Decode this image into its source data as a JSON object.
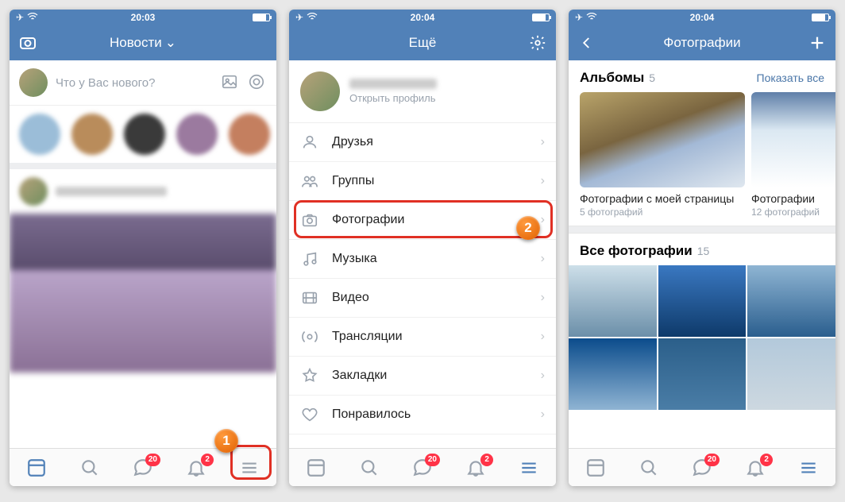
{
  "status": {
    "times": [
      "20:03",
      "20:04",
      "20:04"
    ]
  },
  "screen1": {
    "title": "Новости",
    "composer_placeholder": "Что у Вас нового?"
  },
  "screen2": {
    "title": "Ещё",
    "profile_sub": "Открыть профиль",
    "menu": [
      {
        "icon": "friends",
        "label": "Друзья"
      },
      {
        "icon": "groups",
        "label": "Группы"
      },
      {
        "icon": "photos",
        "label": "Фотографии"
      },
      {
        "icon": "music",
        "label": "Музыка"
      },
      {
        "icon": "video",
        "label": "Видео"
      },
      {
        "icon": "live",
        "label": "Трансляции"
      },
      {
        "icon": "bookmarks",
        "label": "Закладки"
      },
      {
        "icon": "likes",
        "label": "Понравилось"
      }
    ]
  },
  "screen3": {
    "title": "Фотографии",
    "albums_title": "Альбомы",
    "albums_count": "5",
    "show_all": "Показать все",
    "albums": [
      {
        "title": "Фотографии с моей страницы",
        "sub": "5 фотографий"
      },
      {
        "title": "Фотографии",
        "sub": "12 фотографий"
      }
    ],
    "all_title": "Все фотографии",
    "all_count": "15"
  },
  "tabbar": {
    "badge_messages": "20",
    "badge_notifications": "2"
  },
  "callouts": {
    "one": "1",
    "two": "2"
  }
}
